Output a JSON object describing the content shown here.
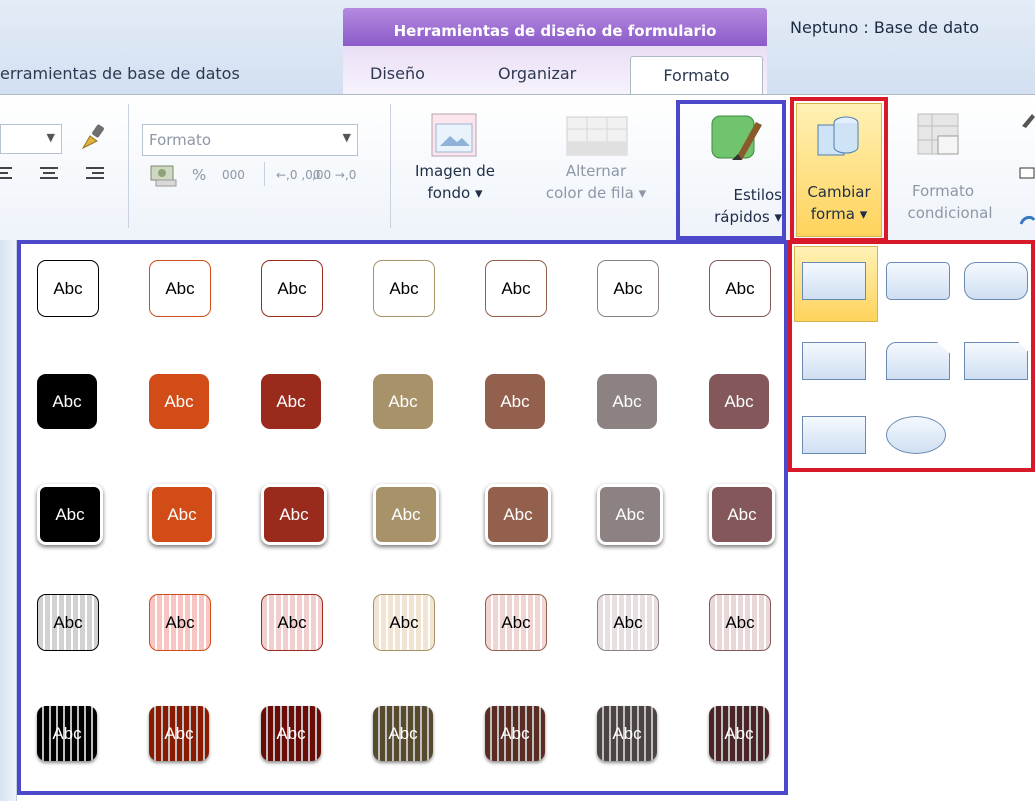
{
  "window": {
    "title": "Neptuno : Base de dato"
  },
  "context_group": {
    "label": "Herramientas de diseño de formulario"
  },
  "tabs": [
    {
      "label": "erramientas de base de datos"
    },
    {
      "label": "Diseño"
    },
    {
      "label": "Organizar"
    },
    {
      "label": "Formato"
    }
  ],
  "ribbon": {
    "number_format": {
      "value": "Formato"
    },
    "number_buttons": {
      "percent": "%",
      "thousands": "000",
      "increase_decimals": "←,0 ,00",
      "decrease_decimals": ",00 →,0"
    },
    "background_image": {
      "line1": "Imagen de",
      "line2": "fondo ▾"
    },
    "alternate_row": {
      "line1": "Alternar",
      "line2": "color de fila ▾"
    },
    "quick_styles": {
      "line1": "Estilos",
      "line2": "rápidos ▾"
    },
    "change_shape": {
      "line1": "Cambiar",
      "line2": "forma ▾"
    },
    "conditional_format": {
      "line1": "Formato",
      "line2": "condicional"
    }
  },
  "style_gallery": {
    "tile_label": "Abc",
    "palette": [
      "#000000",
      "#d24c17",
      "#9a2a1c",
      "#a8926a",
      "#92604c",
      "#8c8282",
      "#84585a"
    ],
    "light_palette": [
      "#d2d2d2",
      "#f9c5c2",
      "#f2cfcf",
      "#f1e4d2",
      "#efd6d2",
      "#e8e0e0",
      "#ead8d8"
    ],
    "dark_palette": [
      "#000000",
      "#8a1a00",
      "#6b0c08",
      "#584a2c",
      "#5b2c22",
      "#4b4442",
      "#4a2426"
    ],
    "rows": [
      "outline",
      "solid",
      "raised",
      "light",
      "dark"
    ]
  },
  "shape_gallery": {
    "shapes": [
      "rectangle",
      "rounded-rectangle",
      "round-rectangle",
      "snip-corner",
      "snip-round",
      "snip-single-corner",
      "rectangle-small-round",
      "oval"
    ]
  },
  "annotations": {
    "blue": "#4b48c9",
    "red": "#d8192a"
  }
}
